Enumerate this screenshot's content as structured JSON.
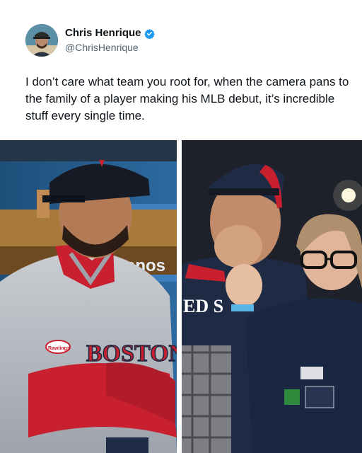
{
  "author": {
    "display_name": "Chris Henrique",
    "handle": "@ChrisHenrique",
    "avatar_icon": "profile-avatar",
    "verified_icon": "verified-badge-icon",
    "verified_color": "#1d9bf0"
  },
  "tweet": {
    "text": "I don’t care what team you root for, when the camera pans to the family of a player making his MLB debut, it’s incredible stuff every single time."
  },
  "photos": {
    "left": {
      "jersey_lettering": "BOSTON",
      "background_sign": "anos",
      "sleeve_logo": "Rawlings"
    },
    "right": {
      "jacket_lettering": "ED S"
    }
  },
  "colors": {
    "text": "#0f1419",
    "secondary_text": "#536471",
    "red_sox_red": "#c8202f",
    "navy": "#1f2a44"
  }
}
